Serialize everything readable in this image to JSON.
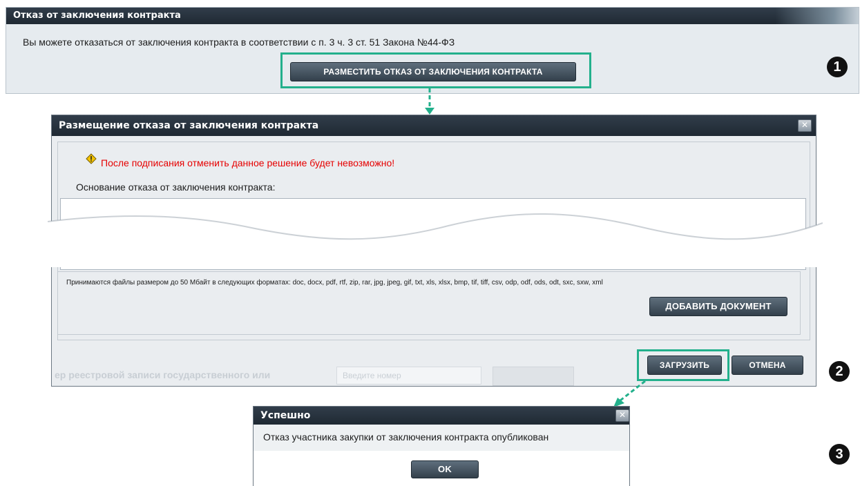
{
  "top_panel": {
    "title": "Отказ от заключения контракта",
    "info": "Вы можете отказаться от заключения контракта в соответствии с п. 3 ч. 3 ст. 51 Закона №44-ФЗ",
    "button_label": "РАЗМЕСТИТЬ ОТКАЗ ОТ ЗАКЛЮЧЕНИЯ КОНТРАКТА"
  },
  "steps": {
    "one": "1",
    "two": "2",
    "three": "3"
  },
  "dialog_refusal": {
    "title": "Размещение отказа от заключения контракта",
    "warning": "После подписания отменить данное решение будет невозможно!",
    "reason_label": "Основание отказа от заключения контракта:",
    "files_hint": "Принимаются файлы размером до 50 Мбайт в следующих форматах: doc, docx, pdf, rtf, zip, rar, jpg, jpeg, gif, txt, xls, xlsx, bmp, tif, tiff, csv, odp, odf, ods, odt, sxc, sxw, xml",
    "add_document_label": "ДОБАВИТЬ ДОКУМЕНТ",
    "upload_label": "ЗАГРУЗИТЬ",
    "cancel_label": "ОТМЕНА",
    "background_field_label": "ер реестровой записи государственного или",
    "background_input_placeholder": "Введите номер"
  },
  "dialog_success": {
    "title": "Успешно",
    "message": "Отказ участника закупки от заключения контракта опубликован",
    "ok_label": "OK"
  },
  "colors": {
    "highlight": "#23b08c",
    "titlebar": "#2a3540",
    "warning_text": "#e60000"
  },
  "icons": [
    "warning-icon",
    "close-icon",
    "globe-icon"
  ]
}
